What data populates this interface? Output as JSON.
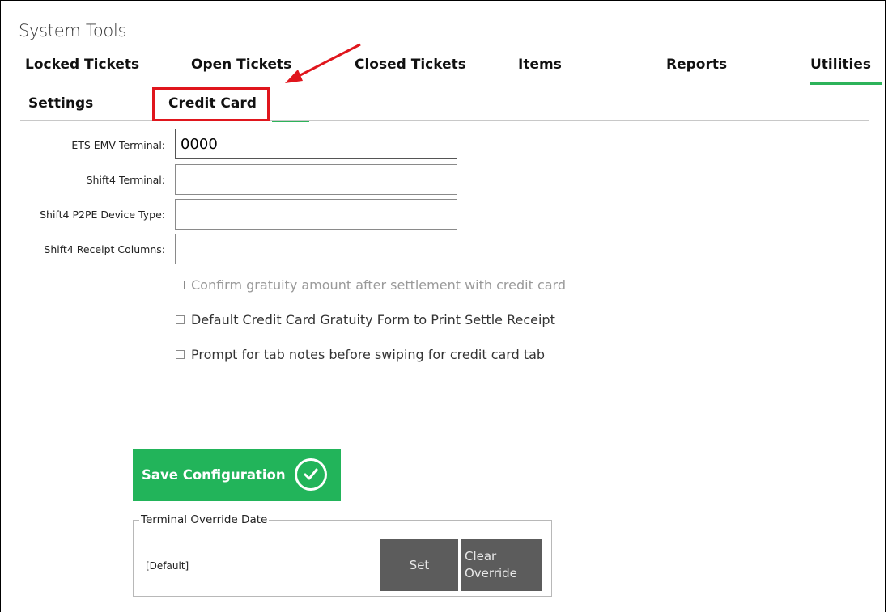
{
  "page": {
    "title": "System Tools"
  },
  "main_tabs": [
    {
      "label": "Locked Tickets"
    },
    {
      "label": "Open Tickets"
    },
    {
      "label": "Closed Tickets"
    },
    {
      "label": "Items"
    },
    {
      "label": "Reports"
    },
    {
      "label": "Utilities",
      "active": true
    }
  ],
  "sub_tabs": [
    {
      "label": "Settings"
    },
    {
      "label": "Credit Card",
      "active": true
    }
  ],
  "fields": [
    {
      "label": "ETS EMV Terminal:",
      "value": "0000"
    },
    {
      "label": "Shift4 Terminal:",
      "value": ""
    },
    {
      "label": "Shift4 P2PE Device Type:",
      "value": ""
    },
    {
      "label": "Shift4 Receipt Columns:",
      "value": ""
    }
  ],
  "options": [
    {
      "label": "Confirm gratuity amount after settlement with credit card",
      "checked": false,
      "enabled": false
    },
    {
      "label": "Default Credit Card Gratuity Form to Print Settle Receipt",
      "checked": false,
      "enabled": true
    },
    {
      "label": "Prompt for tab notes before swiping for credit card tab",
      "checked": false,
      "enabled": true
    }
  ],
  "save_button": {
    "label": "Save Configuration"
  },
  "terminal_override": {
    "legend": "Terminal Override Date",
    "value": "[Default]",
    "set_label": "Set",
    "clear_label_line1": "Clear",
    "clear_label_line2": "Override"
  },
  "colors": {
    "accent": "#2db35a",
    "save_button": "#22b45a",
    "highlight": "#e0161d",
    "gray_button": "#5c5c5c"
  }
}
